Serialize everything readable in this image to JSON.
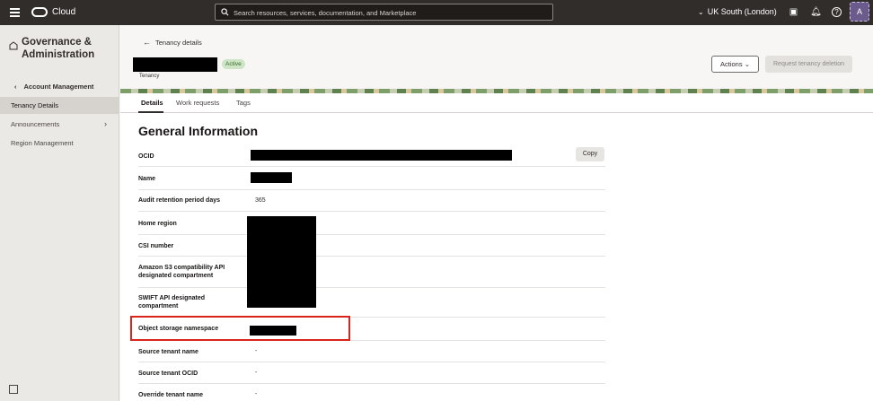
{
  "topbar": {
    "brand": "Cloud",
    "search_placeholder": "Search resources, services, documentation, and Marketplace",
    "region": "UK South (London)",
    "avatar_initial": "A"
  },
  "sidebar": {
    "title": "Governance & Administration",
    "back_label": "Account Management",
    "items": [
      {
        "label": "Tenancy Details"
      },
      {
        "label": "Announcements"
      },
      {
        "label": "Region Management"
      }
    ]
  },
  "header": {
    "back_label": "Tenancy details",
    "status": "Active",
    "subtitle": "Tenancy",
    "actions_label": "Actions",
    "delete_label": "Request tenancy deletion"
  },
  "tabs": [
    {
      "label": "Details"
    },
    {
      "label": "Work requests"
    },
    {
      "label": "Tags"
    }
  ],
  "general": {
    "title": "General Information",
    "copy_label": "Copy",
    "fields": [
      {
        "label": "OCID",
        "value": ""
      },
      {
        "label": "Name",
        "value": ""
      },
      {
        "label": "Audit retention period days",
        "value": "365"
      },
      {
        "label": "Home region",
        "value": ""
      },
      {
        "label": "CSI number",
        "value": ""
      },
      {
        "label": "Amazon S3 compatibility API designated compartment",
        "value": ""
      },
      {
        "label": "SWIFT API designated compartment",
        "value": ""
      },
      {
        "label": "Object storage namespace",
        "value": ""
      },
      {
        "label": "Source tenant name",
        "value": "-"
      },
      {
        "label": "Source tenant OCID",
        "value": "-"
      },
      {
        "label": "Override tenant name",
        "value": "-"
      }
    ]
  }
}
